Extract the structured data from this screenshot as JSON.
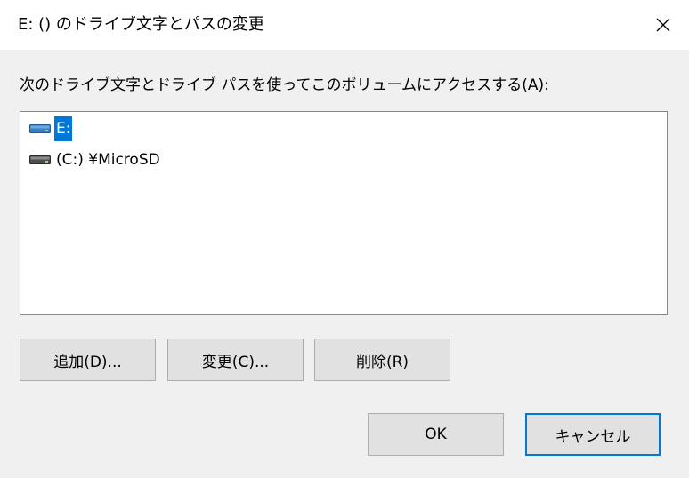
{
  "window": {
    "title": "E: () のドライブ文字とパスの変更",
    "close_icon": "close-icon"
  },
  "dialog": {
    "description": "次のドライブ文字とドライブ パスを使ってこのボリュームにアクセスする(A):",
    "items": [
      {
        "label": "E:",
        "icon": "removable-drive-icon",
        "selected": true
      },
      {
        "label": "(C:) ¥MicroSD",
        "icon": "drive-icon",
        "selected": false
      }
    ],
    "buttons": {
      "add": "追加(D)...",
      "change": "変更(C)...",
      "remove": "削除(R)",
      "ok": "OK",
      "cancel": "キャンセル"
    }
  },
  "colors": {
    "selection": "#0078d7",
    "button_face": "#e1e1e1",
    "dialog_bg": "#f0f0f0"
  }
}
